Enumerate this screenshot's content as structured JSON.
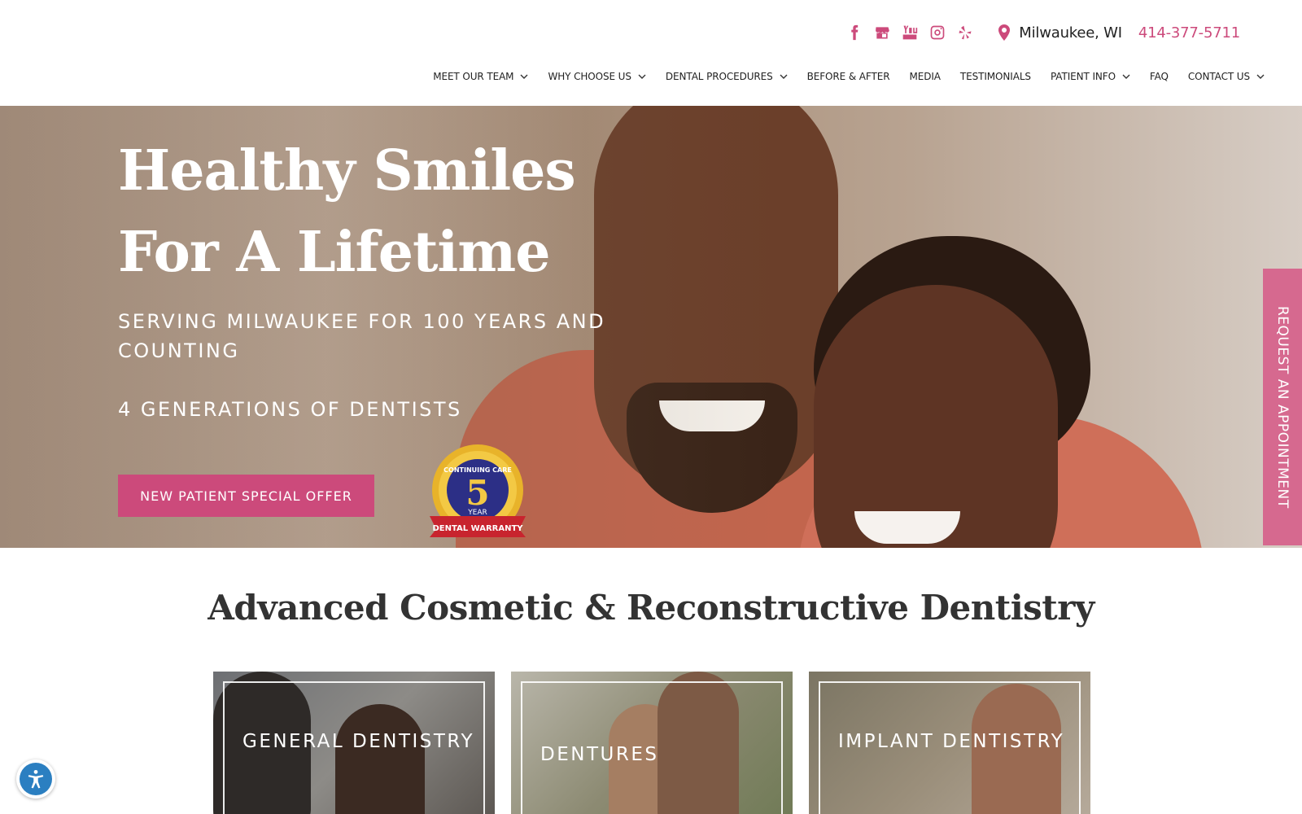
{
  "header": {
    "social_icons": [
      "facebook-icon",
      "google-business-icon",
      "youtube-icon",
      "instagram-icon",
      "yelp-icon"
    ],
    "location": "Milwaukee, WI",
    "phone": "414-377-5711",
    "nav": [
      {
        "label": "MEET OUR TEAM",
        "dropdown": true
      },
      {
        "label": "WHY CHOOSE US",
        "dropdown": true
      },
      {
        "label": "DENTAL PROCEDURES",
        "dropdown": true
      },
      {
        "label": "BEFORE & AFTER",
        "dropdown": false
      },
      {
        "label": "MEDIA",
        "dropdown": false
      },
      {
        "label": "TESTIMONIALS",
        "dropdown": false
      },
      {
        "label": "PATIENT INFO",
        "dropdown": true
      },
      {
        "label": "FAQ",
        "dropdown": false
      },
      {
        "label": "CONTACT US",
        "dropdown": true
      }
    ]
  },
  "hero": {
    "title_line1": "Healthy Smiles",
    "title_line2": "For A Lifetime",
    "subtitle": "SERVING MILWAUKEE FOR 100 YEARS AND COUNTING",
    "subtitle2": "4 GENERATIONS OF DENTISTS",
    "cta": "NEW PATIENT SPECIAL OFFER",
    "badge": {
      "top": "CONTINUING CARE",
      "number": "5",
      "unit": "YEAR",
      "ribbon": "DENTAL WARRANTY"
    }
  },
  "side_tab": "REQUEST AN APPOINTMENT",
  "section": {
    "title": "Advanced Cosmetic & Reconstructive Dentistry",
    "cards": [
      "GENERAL DENTISTRY",
      "DENTURES",
      "IMPLANT DENTISTRY"
    ]
  },
  "colors": {
    "accent": "#cc4a7b",
    "side_tab": "#d6698f",
    "accessibility": "#2b7fc1"
  }
}
